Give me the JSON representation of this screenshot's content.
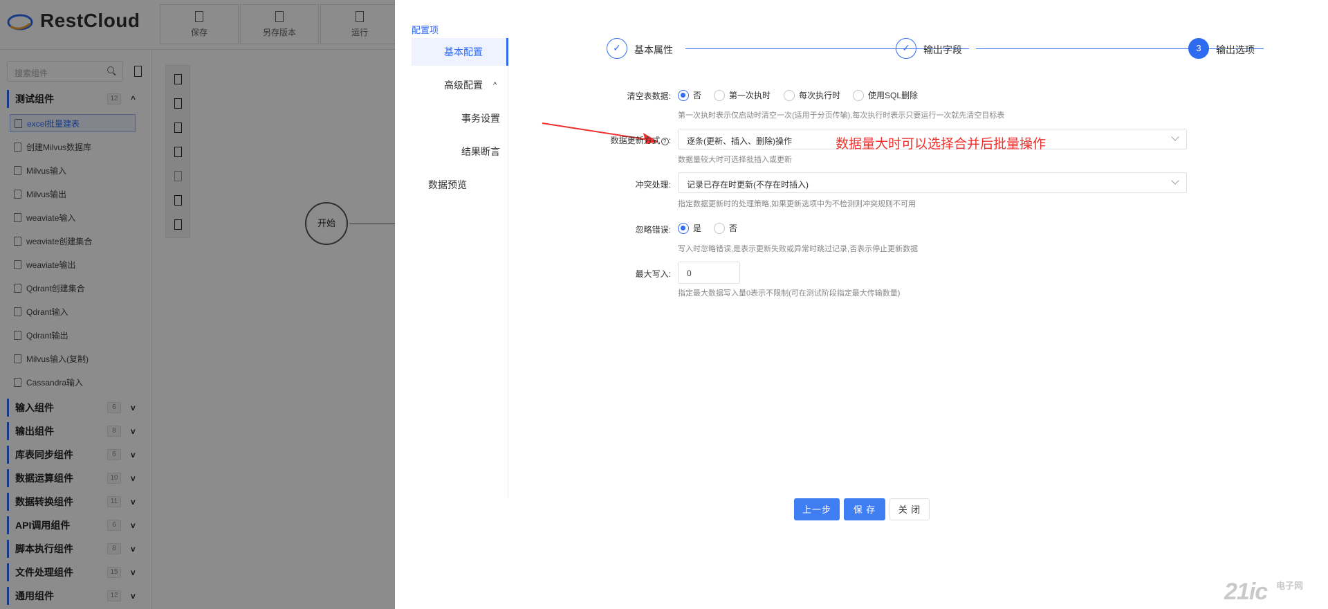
{
  "app": {
    "brand": "RestCloud"
  },
  "toolbar": {
    "save": "保存",
    "save_version": "另存版本",
    "run": "运行"
  },
  "sidebar": {
    "search_placeholder": "搜索组件",
    "categories": [
      {
        "label": "测试组件",
        "count": "12",
        "expanded": true
      },
      {
        "label": "输入组件",
        "count": "6"
      },
      {
        "label": "输出组件",
        "count": "8"
      },
      {
        "label": "库表同步组件",
        "count": "6"
      },
      {
        "label": "数据运算组件",
        "count": "10"
      },
      {
        "label": "数据转换组件",
        "count": "11"
      },
      {
        "label": "API调用组件",
        "count": "6"
      },
      {
        "label": "脚本执行组件",
        "count": "8"
      },
      {
        "label": "文件处理组件",
        "count": "15"
      },
      {
        "label": "通用组件",
        "count": "12"
      }
    ],
    "items": [
      "excel批量建表",
      "创建Milvus数据库",
      "Milvus输入",
      "Milvus输出",
      "weaviate输入",
      "weaviate创建集合",
      "weaviate输出",
      "Qdrant创建集合",
      "Qdrant输入",
      "Qdrant输出",
      "Milvus输入(复制)",
      "Cassandra输入"
    ]
  },
  "canvas": {
    "start_node": "开始"
  },
  "drawer": {
    "menu_title": "配置项",
    "menu": [
      {
        "label": "基本配置",
        "active": true
      },
      {
        "label": "高级配置"
      },
      {
        "label": "事务设置"
      },
      {
        "label": "结果断言"
      },
      {
        "label": "数据预览"
      }
    ],
    "steps": [
      {
        "label": "基本属性",
        "status": "done"
      },
      {
        "label": "输出字段",
        "status": "done"
      },
      {
        "label": "输出选项",
        "status": "current",
        "number": "3"
      }
    ],
    "form": {
      "clear_table": {
        "label": "清空表数据:",
        "options": [
          "否",
          "第一次执时",
          "每次执行时",
          "使用SQL删除"
        ],
        "selected": "否",
        "hint": "第一次执时表示仅启动时清空一次(适用于分页传输),每次执行时表示只要运行一次就先清空目标表"
      },
      "update_mode": {
        "label": "数据更新方式",
        "help_icon": "?",
        "value": "逐条(更新、插入、删除)操作",
        "hint": "数据量较大时可选择批插入或更新"
      },
      "conflict": {
        "label": "冲突处理:",
        "value": "记录已存在时更新(不存在时插入)",
        "hint": "指定数据更新时的处理策略,如果更新选项中为不检测则冲突规则不可用"
      },
      "ignore_errors": {
        "label": "忽略错误:",
        "options": [
          "是",
          "否"
        ],
        "selected": "是",
        "hint": "写入时忽略错误,是表示更新失败或异常时跳过记录,否表示停止更新数据"
      },
      "max_write": {
        "label": "最大写入:",
        "value": "0",
        "hint": "指定最大数据写入量0表示不限制(可在测试阶段指定最大传输数量)"
      }
    },
    "annotation": "数据量大时可以选择合并后批量操作",
    "buttons": {
      "prev": "上一步",
      "save": "保 存",
      "close": "关 闭"
    }
  },
  "watermark": {
    "main": "21ic",
    "sub": "电子网"
  },
  "colors": {
    "accent": "#2f6bf0",
    "annotation": "#f0302c"
  }
}
